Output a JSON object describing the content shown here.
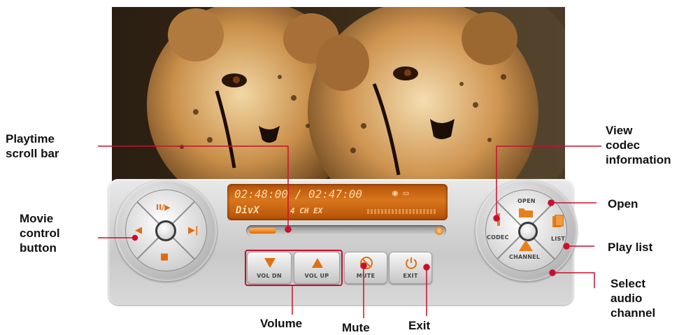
{
  "colors": {
    "accent": "#e06a10",
    "lcd": "#c86410",
    "callout_line": "#c8102e"
  },
  "display": {
    "time": "02:48:00 / 02:47:00",
    "codec": "DivX",
    "audio": "4 CH EX"
  },
  "progress": {
    "fraction": 0.14
  },
  "control_pad": {
    "top": "II/▶",
    "left": "◀",
    "right": "▶|",
    "bottom": "■"
  },
  "right_pad": {
    "open": "OPEN",
    "codec": "CODEC",
    "list": "LIST",
    "channel": "CHANNEL"
  },
  "buttons": {
    "vol_dn": "VOL DN",
    "vol_up": "VOL UP",
    "mute": "MUTE",
    "exit": "EXIT"
  },
  "callouts": {
    "playtime": "Playtime\nscroll bar",
    "movie_control": "Movie\ncontrol\nbutton",
    "view_codec": "View\ncodec\ninformation",
    "open": "Open",
    "play_list": "Play list",
    "select_audio": "Select\naudio\nchannel",
    "volume": "Volume",
    "mute": "Mute",
    "exit": "Exit"
  },
  "icons": {
    "codec": "info-icon",
    "open": "folder-icon",
    "list": "document-icon",
    "channel": "speaker-icon",
    "mute": "mute-icon",
    "exit": "power-icon"
  }
}
